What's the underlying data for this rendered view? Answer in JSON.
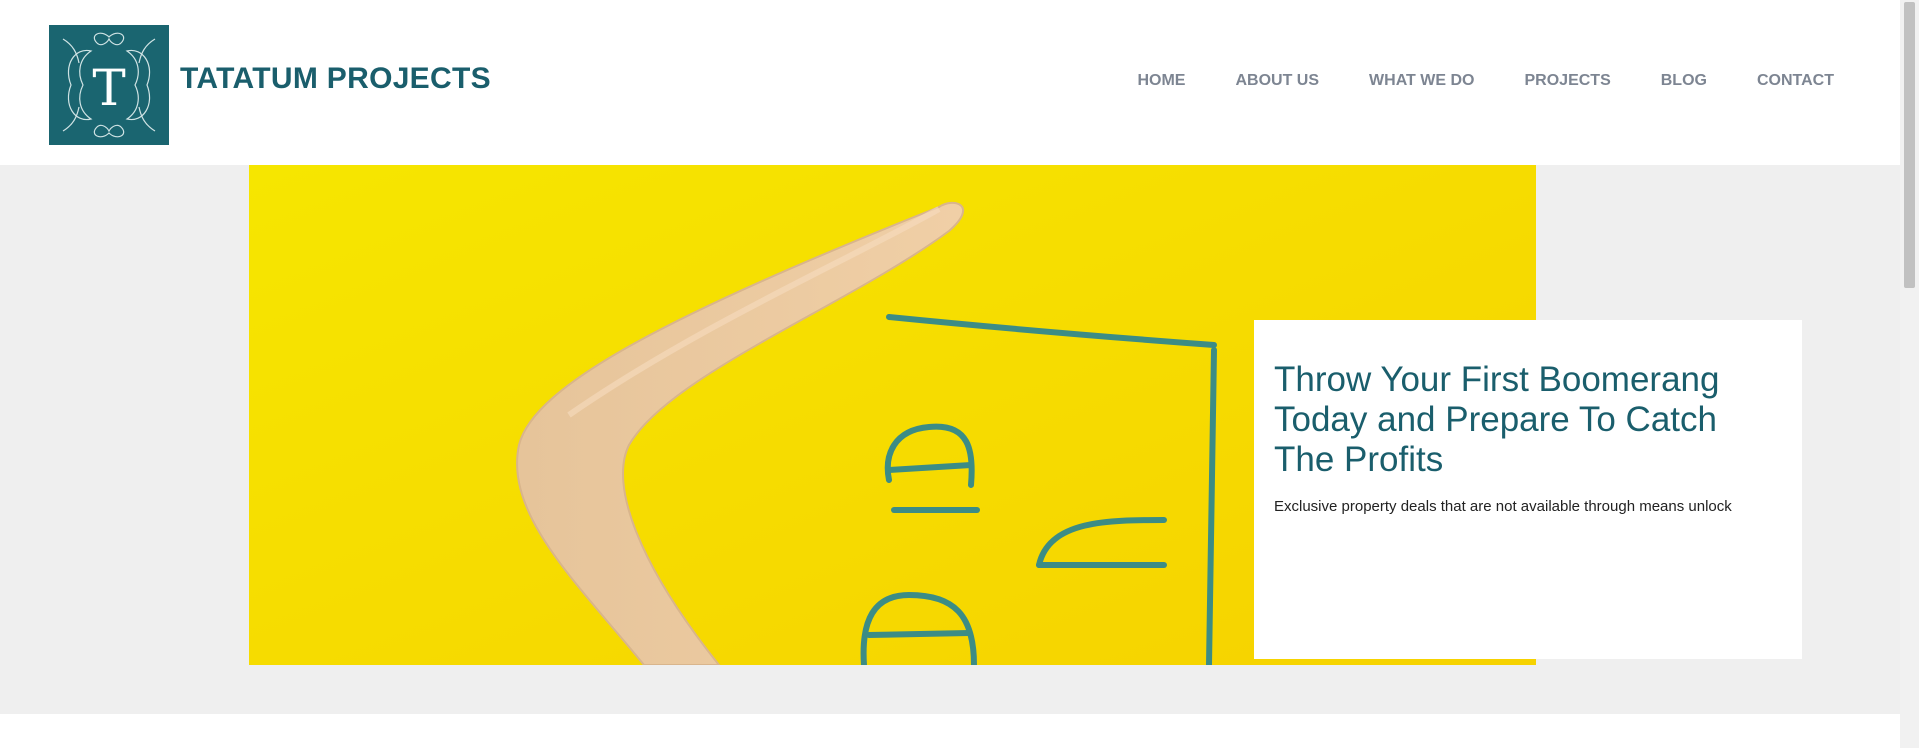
{
  "brand": {
    "name": "TATATUM PROJECTS",
    "logo_letter": "T"
  },
  "nav": [
    {
      "label": "HOME"
    },
    {
      "label": "ABOUT US"
    },
    {
      "label": "WHAT WE DO"
    },
    {
      "label": "PROJECTS"
    },
    {
      "label": "BLOG"
    },
    {
      "label": "CONTACT"
    }
  ],
  "hero": {
    "headline": "Throw Your First Boomerang Today and Prepare To Catch The Profits",
    "subtext": "Exclusive property deals that are not available through means unlock",
    "image_icon": "boomerang-image"
  },
  "colors": {
    "brand_teal": "#1a6570",
    "nav_gray": "#7d8592",
    "hero_yellow": "#f6dc00",
    "band_gray": "#efefef"
  }
}
